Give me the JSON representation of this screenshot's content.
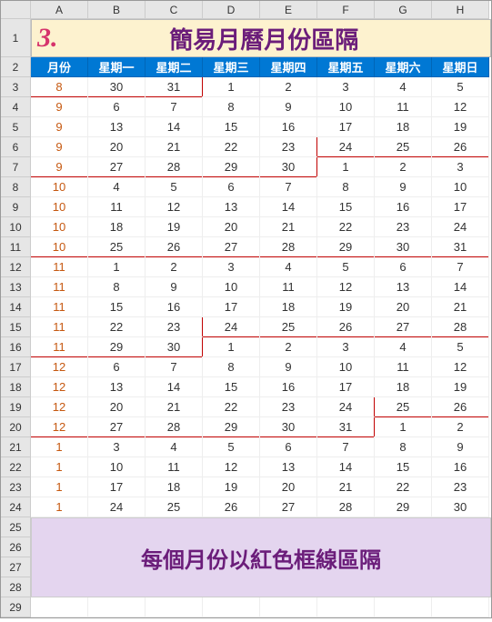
{
  "columns": [
    "A",
    "B",
    "C",
    "D",
    "E",
    "F",
    "G",
    "H"
  ],
  "title": {
    "num": "3.",
    "text": "簡易月曆月份區隔"
  },
  "header2": [
    "月份",
    "星期一",
    "星期二",
    "星期三",
    "星期四",
    "星期五",
    "星期六",
    "星期日"
  ],
  "rows": [
    {
      "n": 3,
      "m": "8",
      "d": [
        30,
        31,
        1,
        2,
        3,
        4,
        5
      ]
    },
    {
      "n": 4,
      "m": "9",
      "d": [
        6,
        7,
        8,
        9,
        10,
        11,
        12
      ]
    },
    {
      "n": 5,
      "m": "9",
      "d": [
        13,
        14,
        15,
        16,
        17,
        18,
        19
      ]
    },
    {
      "n": 6,
      "m": "9",
      "d": [
        20,
        21,
        22,
        23,
        24,
        25,
        26
      ]
    },
    {
      "n": 7,
      "m": "9",
      "d": [
        27,
        28,
        29,
        30,
        1,
        2,
        3
      ]
    },
    {
      "n": 8,
      "m": "10",
      "d": [
        4,
        5,
        6,
        7,
        8,
        9,
        10
      ]
    },
    {
      "n": 9,
      "m": "10",
      "d": [
        11,
        12,
        13,
        14,
        15,
        16,
        17
      ]
    },
    {
      "n": 10,
      "m": "10",
      "d": [
        18,
        19,
        20,
        21,
        22,
        23,
        24
      ]
    },
    {
      "n": 11,
      "m": "10",
      "d": [
        25,
        26,
        27,
        28,
        29,
        30,
        31
      ]
    },
    {
      "n": 12,
      "m": "11",
      "d": [
        1,
        2,
        3,
        4,
        5,
        6,
        7
      ]
    },
    {
      "n": 13,
      "m": "11",
      "d": [
        8,
        9,
        10,
        11,
        12,
        13,
        14
      ]
    },
    {
      "n": 14,
      "m": "11",
      "d": [
        15,
        16,
        17,
        18,
        19,
        20,
        21
      ]
    },
    {
      "n": 15,
      "m": "11",
      "d": [
        22,
        23,
        24,
        25,
        26,
        27,
        28
      ]
    },
    {
      "n": 16,
      "m": "11",
      "d": [
        29,
        30,
        1,
        2,
        3,
        4,
        5
      ]
    },
    {
      "n": 17,
      "m": "12",
      "d": [
        6,
        7,
        8,
        9,
        10,
        11,
        12
      ]
    },
    {
      "n": 18,
      "m": "12",
      "d": [
        13,
        14,
        15,
        16,
        17,
        18,
        19
      ]
    },
    {
      "n": 19,
      "m": "12",
      "d": [
        20,
        21,
        22,
        23,
        24,
        25,
        26
      ]
    },
    {
      "n": 20,
      "m": "12",
      "d": [
        27,
        28,
        29,
        30,
        31,
        1,
        2
      ]
    },
    {
      "n": 21,
      "m": "1",
      "d": [
        3,
        4,
        5,
        6,
        7,
        8,
        9
      ]
    },
    {
      "n": 22,
      "m": "1",
      "d": [
        10,
        11,
        12,
        13,
        14,
        15,
        16
      ]
    },
    {
      "n": 23,
      "m": "1",
      "d": [
        17,
        18,
        19,
        20,
        21,
        22,
        23
      ]
    },
    {
      "n": 24,
      "m": "1",
      "d": [
        24,
        25,
        26,
        27,
        28,
        29,
        30
      ]
    }
  ],
  "emptyRows": [
    25,
    26,
    27,
    28,
    29
  ],
  "footer": "每個月份以紅色框線區隔",
  "redBorders": {
    "3": {
      "bottom": [
        0,
        1,
        2
      ],
      "right": [
        2
      ]
    },
    "6": {
      "bottom": [
        5,
        6,
        7
      ],
      "left": [
        5
      ]
    },
    "7": {
      "bottom": [
        0,
        1,
        2,
        3,
        4
      ],
      "right": [
        4
      ]
    },
    "11": {
      "bottom": [
        0,
        1,
        2,
        3,
        4,
        5,
        6,
        7
      ]
    },
    "15": {
      "bottom": [
        3,
        4,
        5,
        6,
        7
      ],
      "left": [
        3
      ]
    },
    "16": {
      "bottom": [
        0,
        1,
        2
      ],
      "right": [
        2
      ]
    },
    "19": {
      "bottom": [
        6,
        7
      ],
      "left": [
        6
      ]
    },
    "20": {
      "bottom": [
        0,
        1,
        2,
        3,
        4,
        5
      ],
      "right": [
        5
      ]
    }
  },
  "chart_data": {
    "type": "table",
    "title": "簡易月曆月份區隔",
    "columns": [
      "月份",
      "星期一",
      "星期二",
      "星期三",
      "星期四",
      "星期五",
      "星期六",
      "星期日"
    ],
    "data": [
      [
        "8",
        30,
        31,
        1,
        2,
        3,
        4,
        5
      ],
      [
        "9",
        6,
        7,
        8,
        9,
        10,
        11,
        12
      ],
      [
        "9",
        13,
        14,
        15,
        16,
        17,
        18,
        19
      ],
      [
        "9",
        20,
        21,
        22,
        23,
        24,
        25,
        26
      ],
      [
        "9",
        27,
        28,
        29,
        30,
        1,
        2,
        3
      ],
      [
        "10",
        4,
        5,
        6,
        7,
        8,
        9,
        10
      ],
      [
        "10",
        11,
        12,
        13,
        14,
        15,
        16,
        17
      ],
      [
        "10",
        18,
        19,
        20,
        21,
        22,
        23,
        24
      ],
      [
        "10",
        25,
        26,
        27,
        28,
        29,
        30,
        31
      ],
      [
        "11",
        1,
        2,
        3,
        4,
        5,
        6,
        7
      ],
      [
        "11",
        8,
        9,
        10,
        11,
        12,
        13,
        14
      ],
      [
        "11",
        15,
        16,
        17,
        18,
        19,
        20,
        21
      ],
      [
        "11",
        22,
        23,
        24,
        25,
        26,
        27,
        28
      ],
      [
        "11",
        29,
        30,
        1,
        2,
        3,
        4,
        5
      ],
      [
        "12",
        6,
        7,
        8,
        9,
        10,
        11,
        12
      ],
      [
        "12",
        13,
        14,
        15,
        16,
        17,
        18,
        19
      ],
      [
        "12",
        20,
        21,
        22,
        23,
        24,
        25,
        26
      ],
      [
        "12",
        27,
        28,
        29,
        30,
        31,
        1,
        2
      ],
      [
        "1",
        3,
        4,
        5,
        6,
        7,
        8,
        9
      ],
      [
        "1",
        10,
        11,
        12,
        13,
        14,
        15,
        16
      ],
      [
        "1",
        17,
        18,
        19,
        20,
        21,
        22,
        23
      ],
      [
        "1",
        24,
        25,
        26,
        27,
        28,
        29,
        30
      ]
    ],
    "note": "每個月份以紅色框線區隔"
  }
}
